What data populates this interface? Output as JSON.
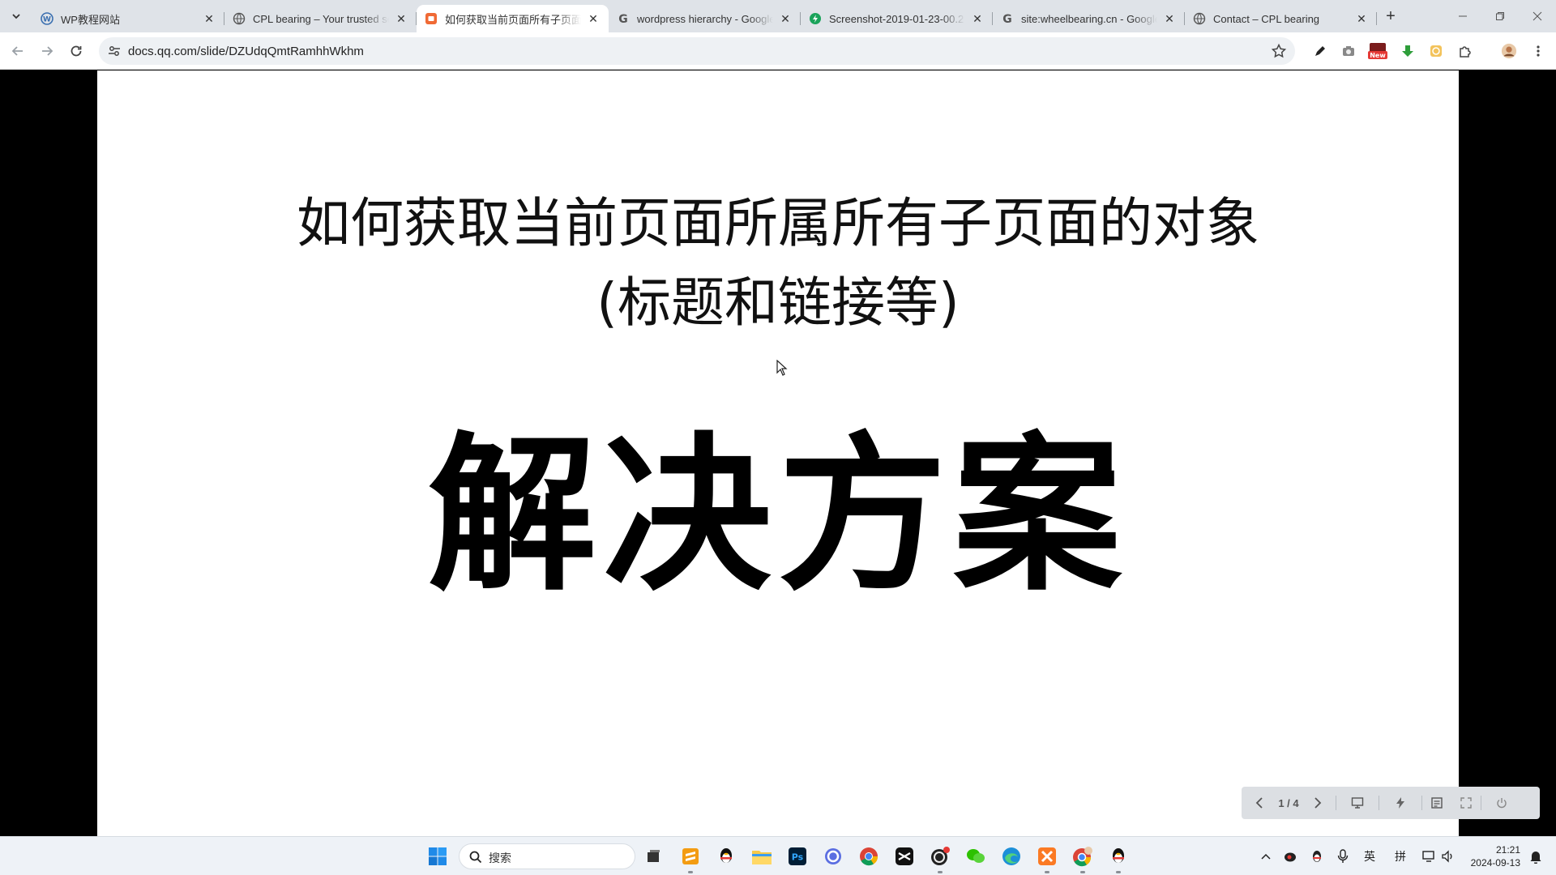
{
  "browser": {
    "tabs": [
      {
        "title": "WP教程网站",
        "favicon": "wordpress-icon",
        "active": false
      },
      {
        "title": "CPL bearing – Your trusted source",
        "favicon": "globe-icon",
        "active": false
      },
      {
        "title": "如何获取当前页面所有子页面的对象",
        "favicon": "tencent-docs-icon",
        "active": true
      },
      {
        "title": "wordpress hierarchy - Google Search",
        "favicon": "google-icon",
        "active": false
      },
      {
        "title": "Screenshot-2019-01-23-00.2",
        "favicon": "green-bolt-icon",
        "active": false
      },
      {
        "title": "site:wheelbearing.cn - Google Search",
        "favicon": "google-icon",
        "active": false
      },
      {
        "title": "Contact – CPL bearing",
        "favicon": "globe-icon",
        "active": false
      }
    ],
    "url": "docs.qq.com/slide/DZUdqQmtRamhhWkhm",
    "ext_badge": "New"
  },
  "slide": {
    "title": "如何获取当前页面所属所有子页面的对象(标题和链接等)",
    "headline": "解决方案",
    "page_indicator": "1 / 4"
  },
  "taskbar": {
    "search_label": "搜索",
    "ime_lang": "英",
    "ime_mode": "拼",
    "time": "21:21",
    "date": "2024-09-13"
  },
  "colors": {
    "tabstrip_bg": "#dfe3e8",
    "slide_bg": "#ffffff",
    "letterbox": "#000000",
    "accent_orange": "#f06a35"
  }
}
